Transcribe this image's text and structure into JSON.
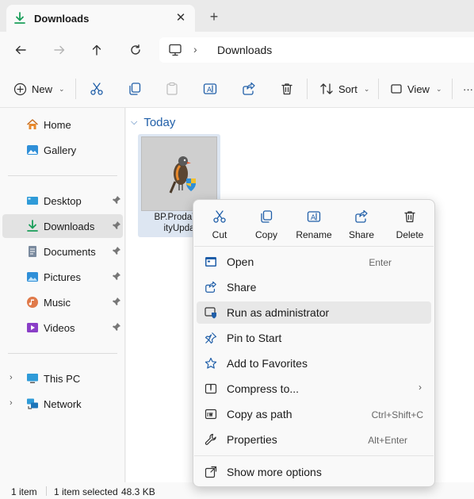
{
  "tab": {
    "title": "Downloads",
    "close_label": "✕",
    "new_tab_label": "+"
  },
  "address": {
    "separator": "›",
    "path": "Downloads"
  },
  "toolbar": {
    "new_label": "New",
    "sort_label": "Sort",
    "view_label": "View",
    "more_label": "···"
  },
  "sidebar": {
    "items": [
      {
        "label": "Home",
        "icon": "home-icon"
      },
      {
        "label": "Gallery",
        "icon": "gallery-icon"
      },
      {
        "label": "Desktop",
        "icon": "desktop-icon",
        "pinned": true
      },
      {
        "label": "Downloads",
        "icon": "download-icon",
        "pinned": true,
        "selected": true
      },
      {
        "label": "Documents",
        "icon": "document-icon",
        "pinned": true
      },
      {
        "label": "Pictures",
        "icon": "picture-icon",
        "pinned": true
      },
      {
        "label": "Music",
        "icon": "music-icon",
        "pinned": true
      },
      {
        "label": "Videos",
        "icon": "video-icon",
        "pinned": true
      },
      {
        "label": "This PC",
        "icon": "pc-icon",
        "expandable": true
      },
      {
        "label": "Network",
        "icon": "network-icon",
        "expandable": true
      }
    ]
  },
  "content": {
    "group_header": "Today",
    "file": {
      "name_line1": "BP.ProdaTls",
      "name_line2": "ityUpda"
    }
  },
  "status": {
    "count": "1 item",
    "selection": "1 item selected",
    "size": "48.3 KB"
  },
  "context_menu": {
    "quick_actions": [
      {
        "label": "Cut",
        "icon": "scissors-icon"
      },
      {
        "label": "Copy",
        "icon": "copy-icon"
      },
      {
        "label": "Rename",
        "icon": "rename-icon"
      },
      {
        "label": "Share",
        "icon": "share-icon"
      },
      {
        "label": "Delete",
        "icon": "trash-icon"
      }
    ],
    "items": [
      {
        "label": "Open",
        "shortcut": "Enter"
      },
      {
        "label": "Share",
        "shortcut": ""
      },
      {
        "label": "Run as administrator",
        "shortcut": "",
        "highlighted": true
      },
      {
        "label": "Pin to Start",
        "shortcut": ""
      },
      {
        "label": "Add to Favorites",
        "shortcut": ""
      },
      {
        "label": "Compress to...",
        "shortcut": "",
        "submenu_arrow": "›"
      },
      {
        "label": "Copy as path",
        "shortcut": "Ctrl+Shift+C"
      },
      {
        "label": "Properties",
        "shortcut": "Alt+Enter"
      }
    ],
    "more_options": "Show more options"
  },
  "colors": {
    "accent": "#1f5ea8",
    "download_green": "#1a9e5a",
    "selection": "#e3e3e3",
    "folder_blue": "#2f8fd8"
  }
}
